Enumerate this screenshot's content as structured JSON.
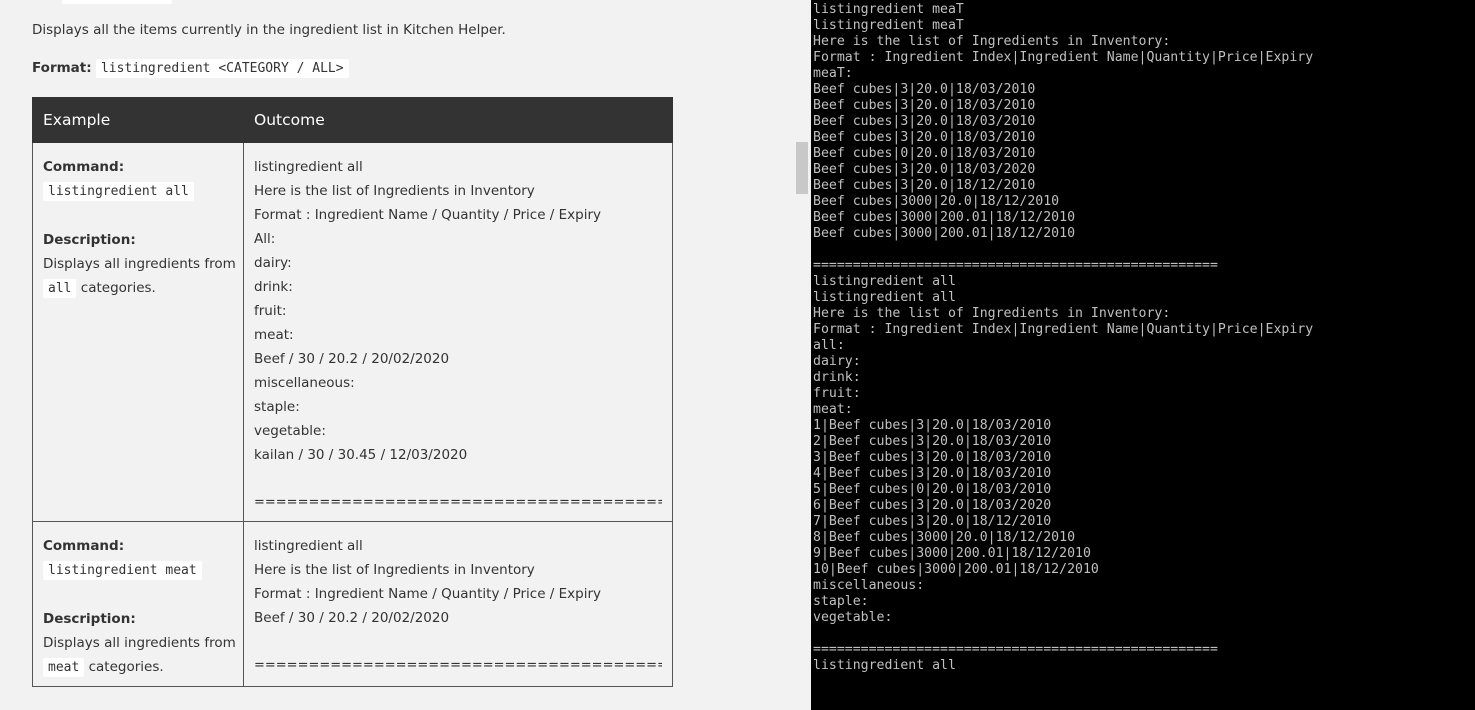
{
  "doc": {
    "description": "Displays all the items currently in the ingredient list in Kitchen Helper.",
    "format_label": "Format:",
    "format_code": "listingredient <CATEGORY / ALL>",
    "table": {
      "headers": [
        "Example",
        "Outcome"
      ],
      "rows": [
        {
          "command_label": "Command:",
          "command_code": "listingredient all",
          "description_label": "Description:",
          "description_pre": "Displays all ingredients from",
          "description_code": "all",
          "description_post": " categories.",
          "outcome": [
            "listingredient all",
            "Here is the list of Ingredients in Inventory",
            "Format : Ingredient Name / Quantity / Price / Expiry",
            "All:",
            "dairy:",
            "drink:",
            "fruit:",
            "meat:",
            "Beef / 30 / 20.2 / 20/02/2020",
            "miscellaneous:",
            "staple:",
            "vegetable:",
            "kailan / 30 / 30.45 / 12/03/2020"
          ],
          "separator": "=============================================================="
        },
        {
          "command_label": "Command:",
          "command_code": "listingredient meat",
          "description_label": "Description:",
          "description_pre": "Displays all ingredients from",
          "description_code": "meat",
          "description_post": " categories.",
          "outcome": [
            "listingredient all",
            "Here is the list of Ingredients in Inventory",
            "Format : Ingredient Name / Quantity / Price / Expiry",
            "Beef / 30 / 20.2 / 20/02/2020"
          ],
          "separator": "=============================================================="
        }
      ]
    }
  },
  "terminal": {
    "lines": [
      "listingredient meaT",
      "listingredient meaT",
      "Here is the list of Ingredients in Inventory:",
      "Format : Ingredient Index|Ingredient Name|Quantity|Price|Expiry",
      "meaT:",
      "Beef cubes|3|20.0|18/03/2010",
      "Beef cubes|3|20.0|18/03/2010",
      "Beef cubes|3|20.0|18/03/2010",
      "Beef cubes|3|20.0|18/03/2010",
      "Beef cubes|0|20.0|18/03/2010",
      "Beef cubes|3|20.0|18/03/2020",
      "Beef cubes|3|20.0|18/12/2010",
      "Beef cubes|3000|20.0|18/12/2010",
      "Beef cubes|3000|200.01|18/12/2010",
      "Beef cubes|3000|200.01|18/12/2010",
      "",
      "===================================================",
      "listingredient all",
      "listingredient all",
      "Here is the list of Ingredients in Inventory:",
      "Format : Ingredient Index|Ingredient Name|Quantity|Price|Expiry",
      "all:",
      "dairy:",
      "drink:",
      "fruit:",
      "meat:",
      "1|Beef cubes|3|20.0|18/03/2010",
      "2|Beef cubes|3|20.0|18/03/2010",
      "3|Beef cubes|3|20.0|18/03/2010",
      "4|Beef cubes|3|20.0|18/03/2010",
      "5|Beef cubes|0|20.0|18/03/2010",
      "6|Beef cubes|3|20.0|18/03/2020",
      "7|Beef cubes|3|20.0|18/12/2010",
      "8|Beef cubes|3000|20.0|18/12/2010",
      "9|Beef cubes|3000|200.01|18/12/2010",
      "10|Beef cubes|3000|200.01|18/12/2010",
      "miscellaneous:",
      "staple:",
      "vegetable:",
      "",
      "===================================================",
      "listingredient all"
    ]
  }
}
